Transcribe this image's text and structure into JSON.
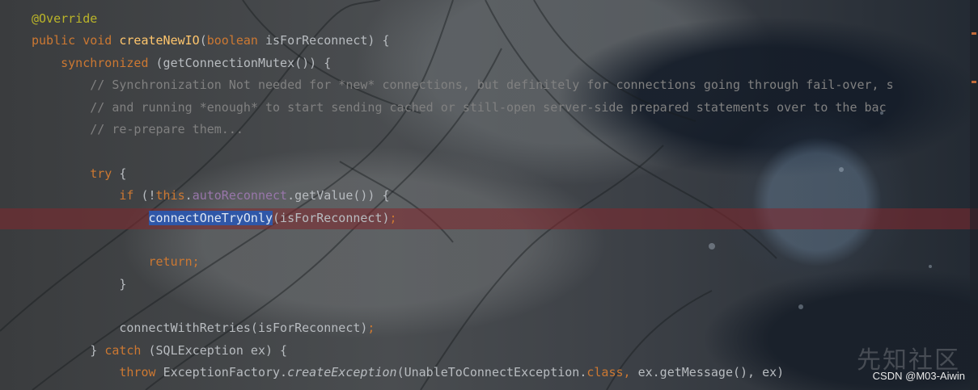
{
  "editor": {
    "lines": [
      [
        {
          "t": "@Override",
          "c": "annotation"
        }
      ],
      [
        {
          "t": "public ",
          "c": "kw"
        },
        {
          "t": "void ",
          "c": "kw"
        },
        {
          "t": "createNewIO",
          "c": "fn"
        },
        {
          "t": "(",
          "c": ""
        },
        {
          "t": "boolean ",
          "c": "kw"
        },
        {
          "t": "isForReconnect) {",
          "c": ""
        }
      ],
      [
        {
          "t": "    ",
          "c": ""
        },
        {
          "t": "synchronized ",
          "c": "kw"
        },
        {
          "t": "(getConnectionMutex()) {",
          "c": ""
        }
      ],
      [
        {
          "t": "        ",
          "c": ""
        },
        {
          "t": "// Synchronization Not needed for *new* connections, but definitely for connections going through fail-over, s",
          "c": "cm"
        }
      ],
      [
        {
          "t": "        ",
          "c": ""
        },
        {
          "t": "// and running *enough* to start sending cached or still-open server-side prepared statements over to the bac",
          "c": "cm"
        }
      ],
      [
        {
          "t": "        ",
          "c": ""
        },
        {
          "t": "// re-prepare them...",
          "c": "cm"
        }
      ],
      [
        {
          "t": "",
          "c": ""
        }
      ],
      [
        {
          "t": "        ",
          "c": ""
        },
        {
          "t": "try ",
          "c": "kw"
        },
        {
          "t": "{",
          "c": ""
        }
      ],
      [
        {
          "t": "            ",
          "c": ""
        },
        {
          "t": "if ",
          "c": "kw"
        },
        {
          "t": "(!",
          "c": ""
        },
        {
          "t": "this",
          "c": "kw"
        },
        {
          "t": ".",
          "c": ""
        },
        {
          "t": "autoReconnect",
          "c": "field"
        },
        {
          "t": ".getValue()) {",
          "c": ""
        }
      ],
      [
        {
          "t": "                ",
          "c": ""
        },
        {
          "t": "connectOneTryOnly",
          "c": "sel"
        },
        {
          "t": "(isForReconnect)",
          "c": ""
        },
        {
          "t": ";",
          "c": "kw"
        }
      ],
      [
        {
          "t": "",
          "c": ""
        }
      ],
      [
        {
          "t": "                ",
          "c": ""
        },
        {
          "t": "return;",
          "c": "kw"
        }
      ],
      [
        {
          "t": "            }",
          "c": ""
        }
      ],
      [
        {
          "t": "",
          "c": ""
        }
      ],
      [
        {
          "t": "            connectWithRetries(isForReconnect)",
          "c": ""
        },
        {
          "t": ";",
          "c": "kw"
        }
      ],
      [
        {
          "t": "        } ",
          "c": ""
        },
        {
          "t": "catch ",
          "c": "kw"
        },
        {
          "t": "(SQLException ex) {",
          "c": ""
        }
      ],
      [
        {
          "t": "            ",
          "c": ""
        },
        {
          "t": "throw ",
          "c": "kw"
        },
        {
          "t": "ExceptionFactory.",
          "c": ""
        },
        {
          "t": "createException",
          "c": "it"
        },
        {
          "t": "(UnableToConnectException.",
          "c": ""
        },
        {
          "t": "class",
          "c": "kw"
        },
        {
          "t": ", ",
          "c": "kw"
        },
        {
          "t": "ex.getMessage(), ex)",
          "c": ""
        }
      ]
    ]
  },
  "watermark": {
    "csdn": "CSDN @M03-Aiwin",
    "logo": "先知社区"
  }
}
